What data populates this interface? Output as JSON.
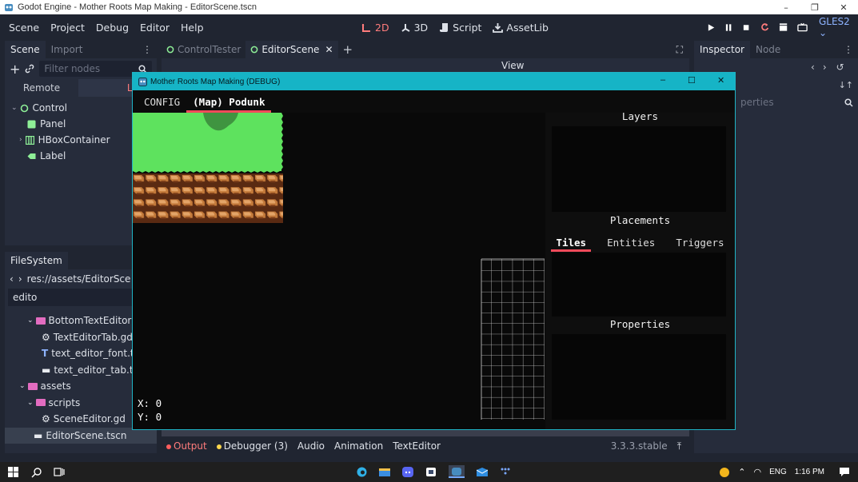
{
  "os_window": {
    "title": "Godot Engine - Mother Roots Map Making - EditorScene.tscn",
    "controls": [
      "–",
      "❐",
      "✕"
    ]
  },
  "menu": {
    "items": [
      "Scene",
      "Project",
      "Debug",
      "Editor",
      "Help"
    ]
  },
  "workspaces": [
    {
      "label": "2D",
      "icon": "2d-icon",
      "active": true
    },
    {
      "label": "3D",
      "icon": "3d-icon",
      "active": false
    },
    {
      "label": "Script",
      "icon": "script-icon",
      "active": false
    },
    {
      "label": "AssetLib",
      "icon": "assetlib-icon",
      "active": false
    }
  ],
  "renderer": "GLES2",
  "scene_dock": {
    "tabs": [
      "Scene",
      "Import"
    ],
    "filter_placeholder": "Filter nodes",
    "remote_label": "Remote",
    "local_label": "Local",
    "tree": [
      {
        "label": "Control",
        "icon": "control-node-icon",
        "color": "#8eef97"
      },
      {
        "label": "Panel",
        "icon": "panel-node-icon",
        "color": "#8eef97"
      },
      {
        "label": "HBoxContainer",
        "icon": "hbox-node-icon",
        "color": "#8eef97"
      },
      {
        "label": "Label",
        "icon": "label-node-icon",
        "color": "#8eef97"
      }
    ]
  },
  "filesystem_dock": {
    "title": "FileSystem",
    "path": "res://assets/EditorSce",
    "filter": "edito",
    "items": [
      {
        "label": "BottomTextEditor",
        "type": "folder"
      },
      {
        "label": "TextEditorTab.gd",
        "type": "script"
      },
      {
        "label": "text_editor_font.tres",
        "type": "font"
      },
      {
        "label": "text_editor_tab.tscn",
        "type": "scene"
      },
      {
        "label": "assets",
        "type": "folder"
      },
      {
        "label": "scripts",
        "type": "folder"
      },
      {
        "label": "SceneEditor.gd",
        "type": "script"
      },
      {
        "label": "EditorScene.tscn",
        "type": "scene"
      }
    ]
  },
  "scene_tabs": [
    {
      "label": "ControlTester",
      "active": false
    },
    {
      "label": "EditorScene",
      "active": true
    }
  ],
  "editor_toolbar": {
    "view_label": "View"
  },
  "bottom_panel": {
    "tabs": [
      {
        "label": "Output",
        "dot": "#ff5d5d"
      },
      {
        "label": "Debugger (3)",
        "dot": "#ffd84d"
      },
      {
        "label": "Audio",
        "dot": null
      },
      {
        "label": "Animation",
        "dot": null
      },
      {
        "label": "TextEditor",
        "dot": null
      }
    ],
    "version": "3.3.3.stable"
  },
  "inspector_dock": {
    "tabs": [
      "Inspector",
      "Node"
    ],
    "filter_partial": "perties"
  },
  "game_window": {
    "title": "Mother Roots Map Making (DEBUG)",
    "tabs": [
      {
        "label": "CONFIG",
        "active": false
      },
      {
        "label": "(Map) Podunk",
        "active": true
      }
    ],
    "coords": {
      "x_label": "X: 0",
      "y_label": "Y: 0"
    },
    "panels": {
      "layers": "Layers",
      "placements": "Placements",
      "properties": "Properties"
    },
    "placement_tabs": [
      {
        "label": "Tiles",
        "active": true
      },
      {
        "label": "Entities",
        "active": false
      },
      {
        "label": "Triggers",
        "active": false
      }
    ],
    "colors": {
      "accent": "#f04a5a",
      "titlebar": "#16b4c6",
      "grass": "#5ee25e",
      "bush": "#3f9440"
    }
  },
  "taskbar": {
    "language": "ENG",
    "time": "1:16 PM"
  }
}
